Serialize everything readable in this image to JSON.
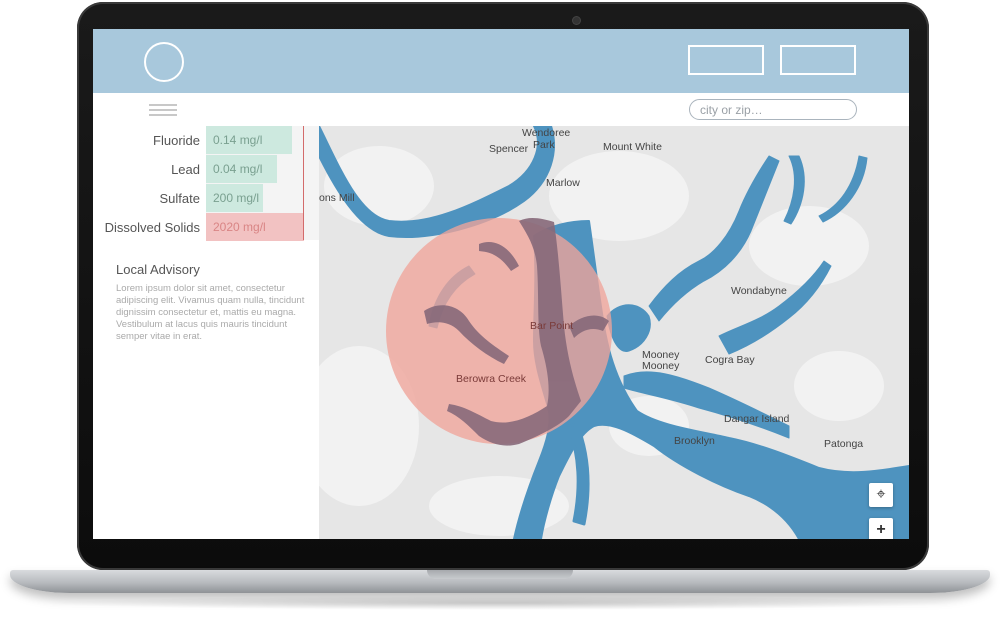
{
  "header": {
    "buttons": [
      "",
      ""
    ]
  },
  "search": {
    "placeholder": "city or zip…"
  },
  "readings": [
    {
      "label": "Fluoride",
      "value": "0.14 mg/l",
      "level": 0.88,
      "status": "ok"
    },
    {
      "label": "Lead",
      "value": "0.04 mg/l",
      "level": 0.72,
      "status": "ok"
    },
    {
      "label": "Sulfate",
      "value": "200 mg/l",
      "level": 0.58,
      "status": "ok"
    },
    {
      "label": "Dissolved Solids",
      "value": "2020 mg/l",
      "level": 1.0,
      "status": "alert"
    }
  ],
  "advisory": {
    "title": "Local Advisory",
    "text": "Lorem ipsum dolor sit amet, consectetur adipiscing elit. Vivamus quam nulla, tincidunt dignissim consectetur et, mattis eu magna. Vestibulum at lacus quis mauris tincidunt semper vitae in erat."
  },
  "map": {
    "places": [
      "Wendoree Park",
      "Spencer",
      "Mount White",
      "Marlow",
      "ons Mill",
      "Bar Point",
      "Berowra Creek",
      "Wondabyne",
      "Mooney Mooney",
      "Cogra Bay",
      "Dangar Island",
      "Brooklyn",
      "Patonga"
    ],
    "controls": {
      "locate_icon": "crosshair-icon",
      "zoom_in": "+"
    }
  },
  "colors": {
    "header": "#a8c8dc",
    "water": "#4e93bf",
    "land": "#e9e9e9",
    "ok_fill": "#cde9df",
    "alert_fill": "#f2c2c2",
    "advisory_circle": "#f0a49a"
  }
}
